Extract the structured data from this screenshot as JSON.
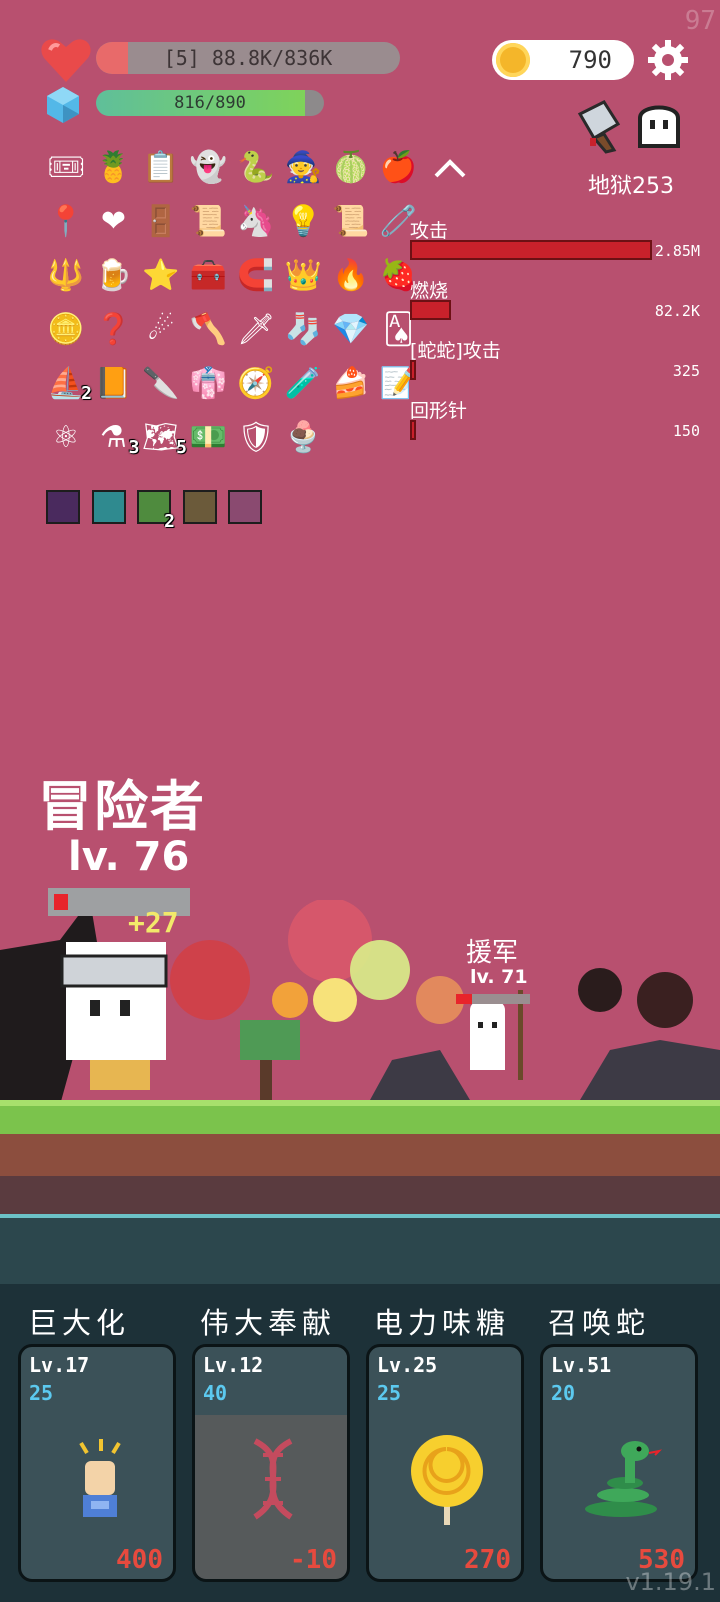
{
  "fps": "97",
  "hp": {
    "text": "[5] 88.8K/836K",
    "fraction": 0.106
  },
  "mp": {
    "text": "816/890",
    "fraction": 0.917
  },
  "coins": "790",
  "stage": "地狱253",
  "inventory": {
    "rows": [
      [
        {
          "icon": "ticket-icon",
          "glyph": "🎟"
        },
        {
          "icon": "pineapple-icon",
          "glyph": "🍍"
        },
        {
          "icon": "checklist-icon",
          "glyph": "📋"
        },
        {
          "icon": "ghost-icon",
          "glyph": "👻"
        },
        {
          "icon": "snake-icon",
          "glyph": "🐍"
        },
        {
          "icon": "wizard-hat-icon",
          "glyph": "🧙"
        },
        {
          "icon": "melon-icon",
          "glyph": "🍈"
        },
        {
          "icon": "apple-icon",
          "glyph": "🍎"
        }
      ],
      [
        {
          "icon": "map-pin-icon",
          "glyph": "📍"
        },
        {
          "icon": "heart-icon",
          "glyph": "❤"
        },
        {
          "icon": "arch-door-icon",
          "glyph": "🚪"
        },
        {
          "icon": "scroll-map-icon",
          "glyph": "📜"
        },
        {
          "icon": "unicorn-icon",
          "glyph": "🦄"
        },
        {
          "icon": "lightbulb-icon",
          "glyph": "💡"
        },
        {
          "icon": "scroll-icon",
          "glyph": "📜"
        },
        {
          "icon": "safety-pin-icon",
          "glyph": "🧷"
        }
      ],
      [
        {
          "icon": "mace-icon",
          "glyph": "🔱"
        },
        {
          "icon": "beer-icon",
          "glyph": "🍺"
        },
        {
          "icon": "star-card-icon",
          "glyph": "⭐"
        },
        {
          "icon": "toolbox-icon",
          "glyph": "🧰"
        },
        {
          "icon": "magnet-icon",
          "glyph": "🧲"
        },
        {
          "icon": "crown-icon",
          "glyph": "👑"
        },
        {
          "icon": "flame-icon",
          "glyph": "🔥"
        },
        {
          "icon": "strawberry-icon",
          "glyph": "🍓"
        }
      ],
      [
        {
          "icon": "coins-icon",
          "glyph": "🪙"
        },
        {
          "icon": "hook-icon",
          "glyph": "❓"
        },
        {
          "icon": "meteors-icon",
          "glyph": "☄"
        },
        {
          "icon": "battle-axe-icon",
          "glyph": "🪓"
        },
        {
          "icon": "sword-icon",
          "glyph": "🗡"
        },
        {
          "icon": "sock-icon",
          "glyph": "🧦"
        },
        {
          "icon": "ruby-icon",
          "glyph": "💎"
        },
        {
          "icon": "playing-card-icon",
          "glyph": "🂡"
        }
      ],
      [
        {
          "icon": "pirate-ship-icon",
          "glyph": "⛵",
          "count": "2"
        },
        {
          "icon": "book-icon",
          "glyph": "📙"
        },
        {
          "icon": "scalpel-icon",
          "glyph": "🔪"
        },
        {
          "icon": "robe-icon",
          "glyph": "👘"
        },
        {
          "icon": "compass-icon",
          "glyph": "🧭"
        },
        {
          "icon": "potion-icon",
          "glyph": "🧪"
        },
        {
          "icon": "cake-icon",
          "glyph": "🍰"
        },
        {
          "icon": "note-pencil-icon",
          "glyph": "📝"
        }
      ],
      [
        {
          "icon": "molecule-icon",
          "glyph": "⚛"
        },
        {
          "icon": "red-flask-icon",
          "glyph": "⚗",
          "count": "3"
        },
        {
          "icon": "folded-map-icon",
          "glyph": "🗺",
          "count": "5"
        },
        {
          "icon": "money-heart-icon",
          "glyph": "💵"
        },
        {
          "icon": "shield-icon",
          "glyph": "🛡"
        },
        {
          "icon": "ice-cream-icon",
          "glyph": "🍨"
        }
      ]
    ],
    "cards": [
      {
        "icon": "demon-card-icon",
        "color": "#4a2a5e"
      },
      {
        "icon": "light-card-icon",
        "color": "#2f8a8f"
      },
      {
        "icon": "check-card-icon",
        "color": "#4f8b3e",
        "count": "2"
      },
      {
        "icon": "burst-card-icon",
        "color": "#6b5a3a"
      },
      {
        "icon": "totem-card-icon",
        "color": "#8a4a70"
      }
    ]
  },
  "damage": [
    {
      "label": "攻击",
      "value": "2.85M",
      "fraction": 1.0
    },
    {
      "label": "燃烧",
      "value": "82.2K",
      "fraction": 0.17
    },
    {
      "label": "[蛇蛇]攻击",
      "value": "325",
      "fraction": 0.02
    },
    {
      "label": "回形针",
      "value": "150",
      "fraction": 0.02
    }
  ],
  "player": {
    "name": "冒险者",
    "level": "lv. 76",
    "xp_gain": "+27"
  },
  "ally": {
    "name": "援军",
    "level": "lv. 71",
    "hp_fraction": 0.22
  },
  "skills": [
    {
      "name": "巨大化",
      "level": "Lv.17",
      "cost": "25",
      "price": "400",
      "icon": "fist-icon",
      "locked": false
    },
    {
      "name": "伟大奉献",
      "level": "Lv.12",
      "cost": "40",
      "price": "-10",
      "icon": "dna-icon",
      "locked": true
    },
    {
      "name": "电力味糖",
      "level": "Lv.25",
      "cost": "25",
      "price": "270",
      "icon": "lollipop-icon",
      "locked": false
    },
    {
      "name": "召唤蛇",
      "level": "Lv.51",
      "cost": "20",
      "price": "530",
      "icon": "snake-icon",
      "locked": false
    }
  ],
  "version": "v1.19.1"
}
